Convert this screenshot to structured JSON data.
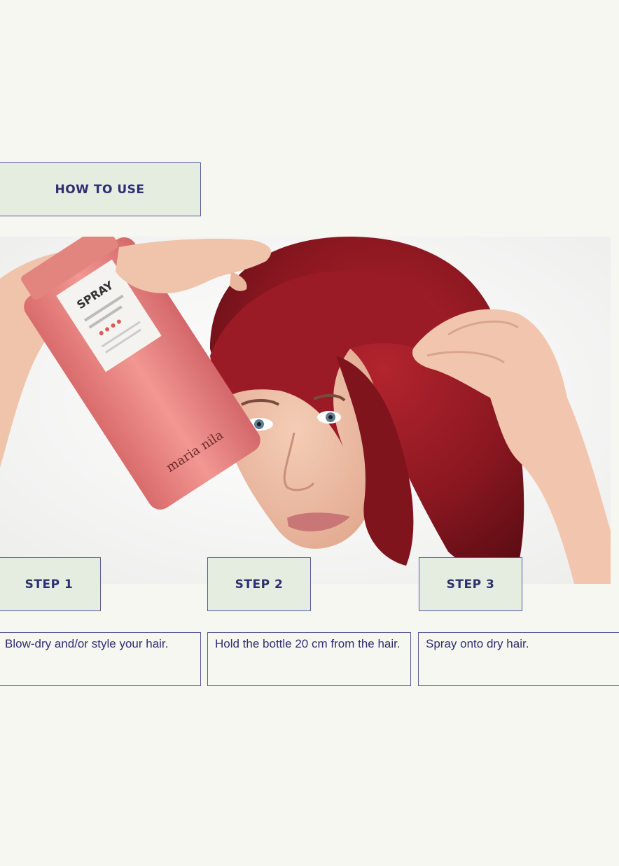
{
  "section": {
    "title": "HOW TO USE"
  },
  "photo": {
    "bottle_brand": "maria nila",
    "bottle_label": "SPRAY"
  },
  "steps": [
    {
      "label": "STEP 1",
      "text": "Blow-dry and/or style your hair."
    },
    {
      "label": "STEP 2",
      "text": "Hold the bottle 20 cm from the hair."
    },
    {
      "label": "STEP 3",
      "text": "Spray onto dry hair."
    }
  ],
  "colors": {
    "background": "#f5f7f0",
    "box_fill": "#e5ede0",
    "accent_text": "#2e2e72",
    "hair": "#8e1a22",
    "bottle": "#e7817e"
  }
}
